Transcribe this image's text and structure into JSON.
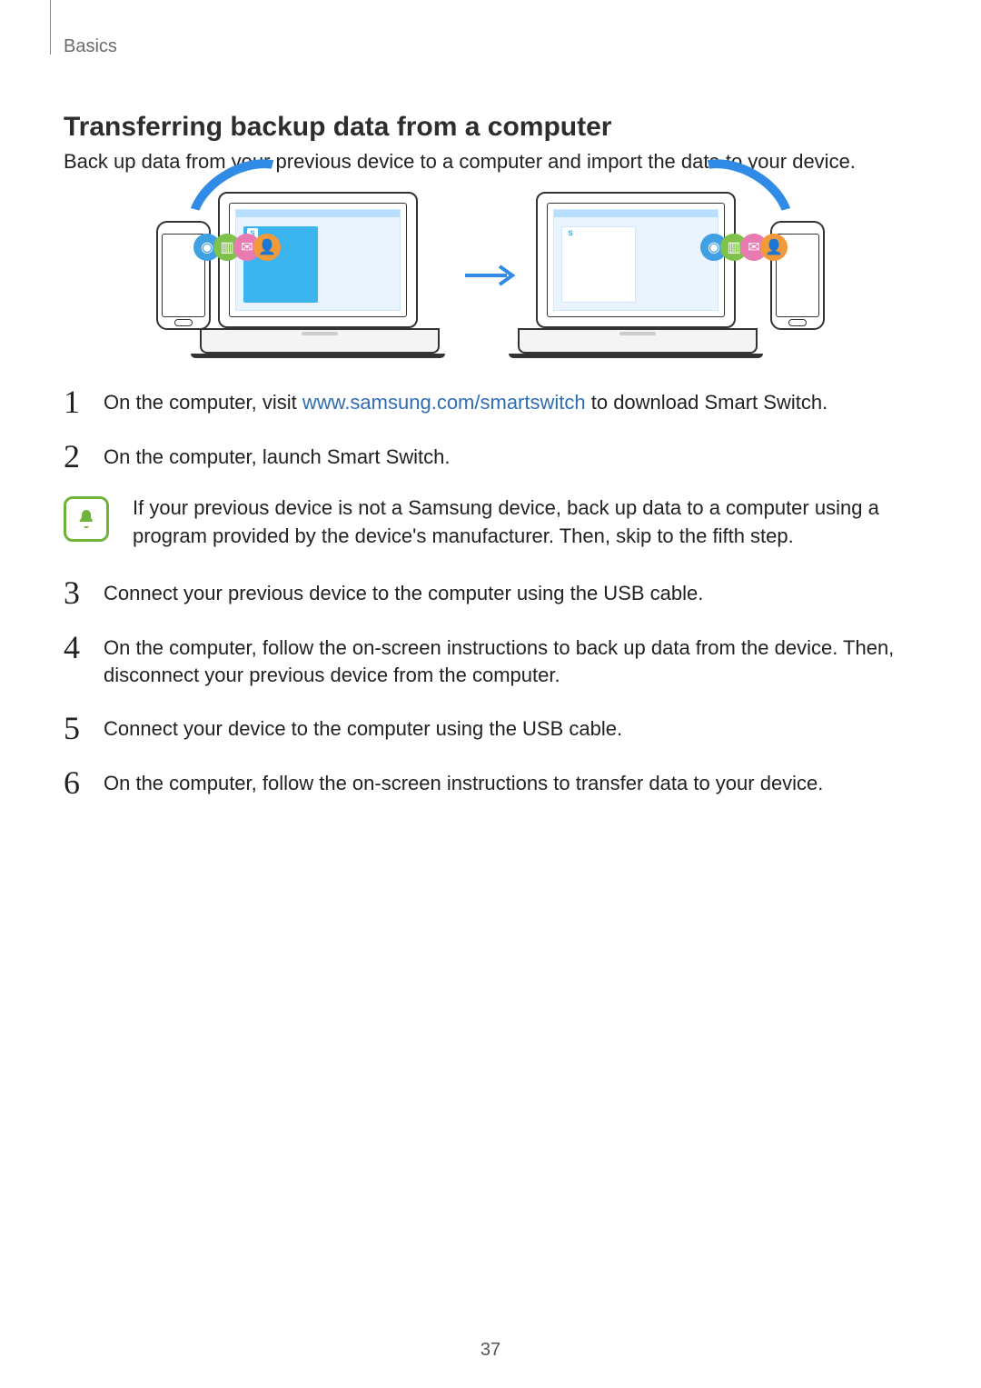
{
  "breadcrumb": "Basics",
  "heading": "Transferring backup data from a computer",
  "intro": "Back up data from your previous device to a computer and import the data to your device.",
  "link": {
    "url_text": "www.samsung.com/smartswitch"
  },
  "steps": {
    "s1": {
      "num": "1",
      "pre": "On the computer, visit ",
      "post": " to download Smart Switch."
    },
    "s2": {
      "num": "2",
      "text": "On the computer, launch Smart Switch."
    },
    "s3": {
      "num": "3",
      "text": "Connect your previous device to the computer using the USB cable."
    },
    "s4": {
      "num": "4",
      "text": "On the computer, follow the on-screen instructions to back up data from the device. Then, disconnect your previous device from the computer."
    },
    "s5": {
      "num": "5",
      "text": "Connect your device to the computer using the USB cable."
    },
    "s6": {
      "num": "6",
      "text": "On the computer, follow the on-screen instructions to transfer data to your device."
    }
  },
  "note": "If your previous device is not a Samsung device, back up data to a computer using a program provided by the device's manufacturer. Then, skip to the fifth step.",
  "page_number": "37"
}
